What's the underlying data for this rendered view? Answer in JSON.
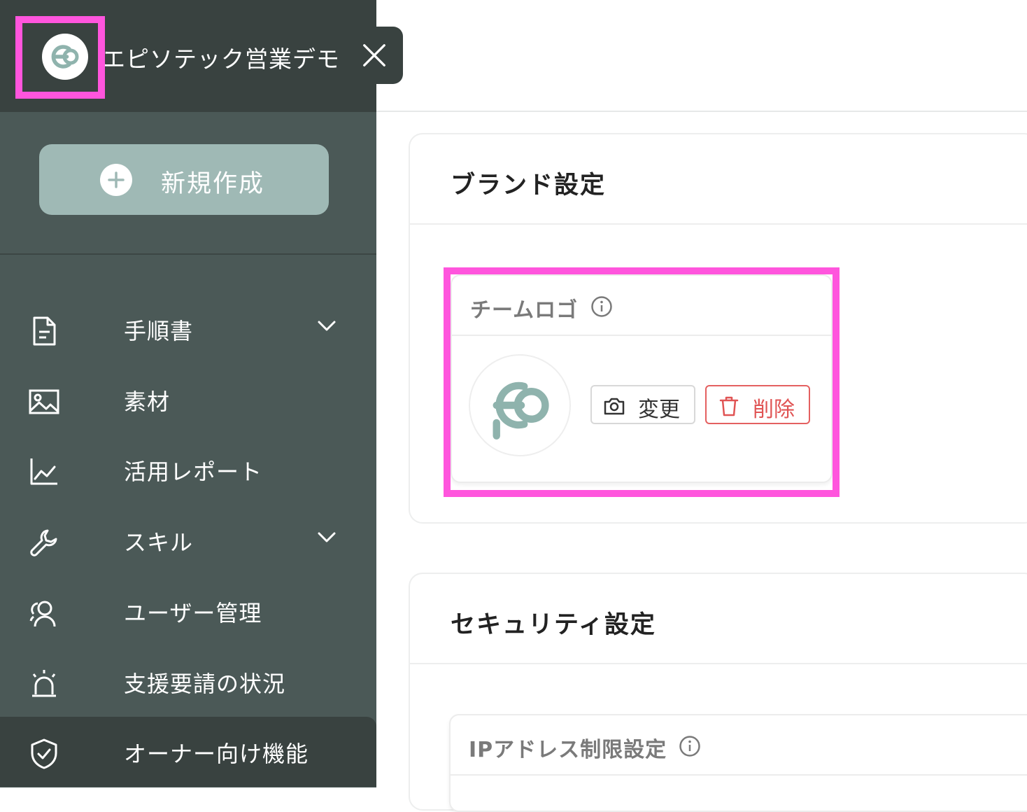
{
  "sidebar": {
    "team_name": "エピソテック営業デモ",
    "team_logo_icon": "team-logo-icon",
    "close_icon": "close-icon",
    "new_button_label": "新規作成",
    "items": [
      {
        "label": "手順書",
        "icon": "document-icon",
        "has_chevron": true
      },
      {
        "label": "素材",
        "icon": "image-icon",
        "has_chevron": false
      },
      {
        "label": "活用レポート",
        "icon": "chart-icon",
        "has_chevron": false
      },
      {
        "label": "スキル",
        "icon": "wrench-icon",
        "has_chevron": true
      },
      {
        "label": "ユーザー管理",
        "icon": "users-icon",
        "has_chevron": false
      },
      {
        "label": "支援要請の状況",
        "icon": "alarm-icon",
        "has_chevron": false
      },
      {
        "label": "オーナー向け機能",
        "icon": "shield-check-icon",
        "has_chevron": false,
        "active": true
      }
    ]
  },
  "brand": {
    "title": "ブランド設定",
    "team_logo": {
      "title": "チームロゴ",
      "change_label": "変更",
      "delete_label": "削除"
    }
  },
  "security": {
    "title": "セキュリティ設定",
    "ip_restriction": {
      "title": "IPアドレス制限設定"
    }
  },
  "colors": {
    "sidebar_bg": "#4b5957",
    "sidebar_header_bg": "#394240",
    "new_button_bg": "#9fb9b5",
    "highlight": "#ff55dd",
    "danger": "#e05454",
    "logo_teal": "#8fb3ad"
  }
}
